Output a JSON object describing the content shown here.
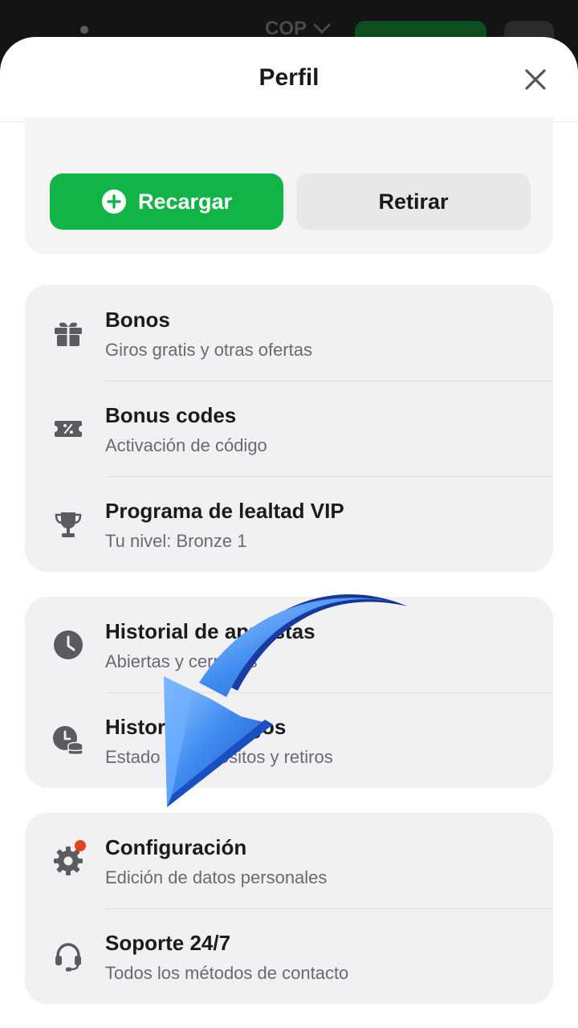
{
  "background": {
    "currency": "COP"
  },
  "sheet": {
    "title": "Perfil"
  },
  "balance": {
    "recharge_label": "Recargar",
    "withdraw_label": "Retirar"
  },
  "menu_group_1": [
    {
      "icon": "gift-icon",
      "title": "Bonos",
      "subtitle": "Giros gratis y otras ofertas"
    },
    {
      "icon": "ticket-percent-icon",
      "title": "Bonus codes",
      "subtitle": "Activación de código"
    },
    {
      "icon": "trophy-icon",
      "title": "Programa de lealtad VIP",
      "subtitle": "Tu nivel: Bronze 1"
    }
  ],
  "menu_group_2": [
    {
      "icon": "clock-icon",
      "title": "Historial de apuestas",
      "subtitle": "Abiertas y cerradas"
    },
    {
      "icon": "clock-coins-icon",
      "title": "Historial de pagos",
      "subtitle": "Estado de depósitos y retiros"
    }
  ],
  "menu_group_3": [
    {
      "icon": "gear-icon",
      "title": "Configuración",
      "subtitle": "Edición de datos personales"
    },
    {
      "icon": "headset-icon",
      "title": "Soporte 24/7",
      "subtitle": "Todos los métodos de contacto"
    }
  ],
  "colors": {
    "accent_green": "#12b347",
    "notification_dot": "#e0441f",
    "arrow_blue": "#3f8cf0"
  }
}
